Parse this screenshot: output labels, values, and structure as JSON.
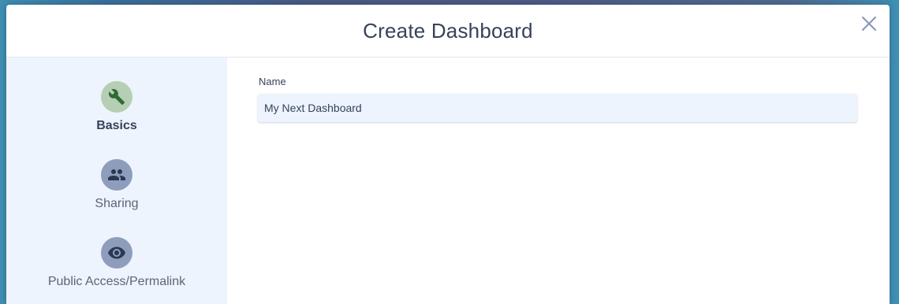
{
  "modal": {
    "title": "Create Dashboard",
    "close_icon": "close-icon"
  },
  "sidebar": {
    "steps": [
      {
        "label": "Basics",
        "icon": "wrench-icon",
        "active": true,
        "circle_color": "#b6cfb4",
        "icon_color": "#2e6b36"
      },
      {
        "label": "Sharing",
        "icon": "people-icon",
        "active": false,
        "circle_color": "#8f9dbd",
        "icon_color": "#2b3852"
      },
      {
        "label": "Public Access/Permalink",
        "icon": "eye-icon",
        "active": false,
        "circle_color": "#8f9dbd",
        "icon_color": "#2b3852"
      }
    ]
  },
  "form": {
    "name_label": "Name",
    "name_value": "My Next Dashboard"
  },
  "colors": {
    "title_text": "#37425a",
    "sidebar_bg": "#edf4fd",
    "input_bg": "#edf4fd",
    "close_icon": "#8796b8"
  }
}
